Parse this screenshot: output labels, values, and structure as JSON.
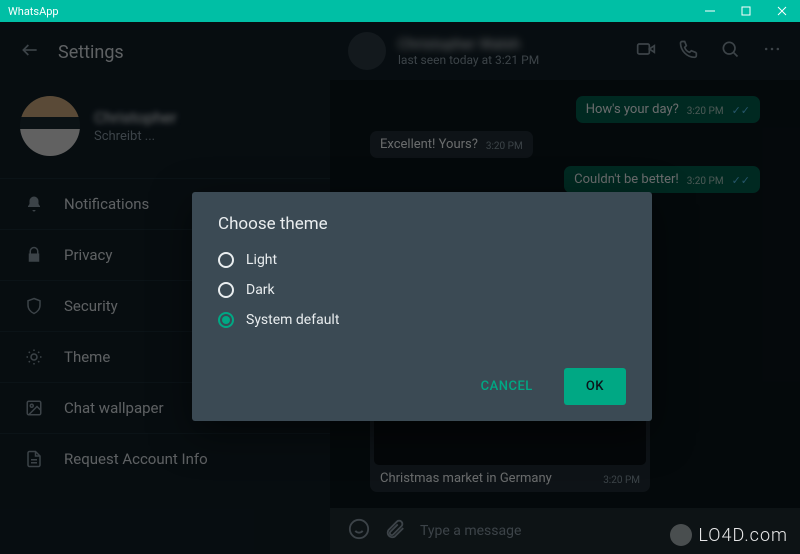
{
  "titlebar": {
    "title": "WhatsApp"
  },
  "sidebar": {
    "back_label": "Back",
    "title": "Settings",
    "profile": {
      "name": "Christopher",
      "status": "Schreibt ..."
    },
    "items": [
      {
        "label": "Notifications",
        "icon": "bell-icon"
      },
      {
        "label": "Privacy",
        "icon": "lock-icon"
      },
      {
        "label": "Security",
        "icon": "shield-icon"
      },
      {
        "label": "Theme",
        "icon": "theme-icon"
      },
      {
        "label": "Chat wallpaper",
        "icon": "wallpaper-icon"
      },
      {
        "label": "Request Account Info",
        "icon": "document-icon"
      }
    ]
  },
  "chat": {
    "contact_name": "Christopher Walsh",
    "last_seen": "last seen today at 3:21 PM",
    "messages": [
      {
        "dir": "out",
        "text": "How's your day?",
        "time": "3:20 PM",
        "ticks": true
      },
      {
        "dir": "in",
        "text": "Excellent! Yours?",
        "time": "3:20 PM"
      },
      {
        "dir": "out",
        "text": "Couldn't be better!",
        "time": "3:20 PM",
        "ticks": true
      }
    ],
    "media": {
      "caption": "Christmas market in Germany",
      "time": "3:20 PM"
    },
    "composer_placeholder": "Type a message"
  },
  "modal": {
    "title": "Choose theme",
    "options": [
      {
        "label": "Light",
        "checked": false
      },
      {
        "label": "Dark",
        "checked": false
      },
      {
        "label": "System default",
        "checked": true
      }
    ],
    "cancel": "CANCEL",
    "ok": "OK"
  },
  "watermark": "LO4D.com"
}
